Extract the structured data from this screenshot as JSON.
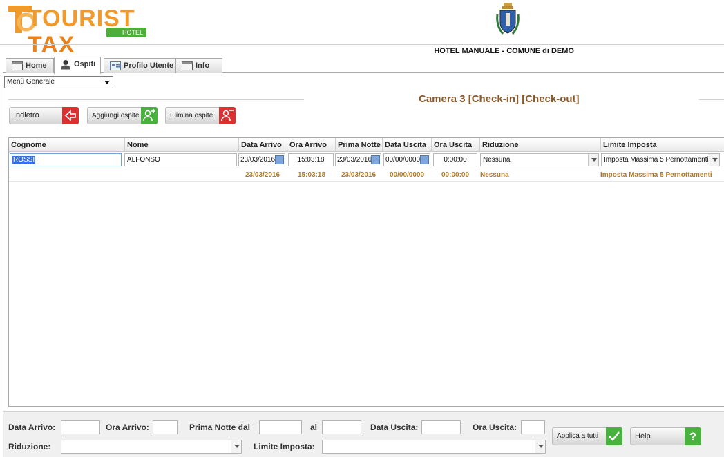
{
  "header": {
    "logo_main": "TOURIST",
    "logo_tax": "TAX",
    "logo_sub": "HOTEL",
    "hotel_name": "HOTEL MANUALE - COMUNE di DEMO"
  },
  "tabs": [
    {
      "label": "Home",
      "icon": "home-icon"
    },
    {
      "label": "Ospiti",
      "icon": "user-icon"
    },
    {
      "label": "Profilo Utente",
      "icon": "id-card-icon"
    },
    {
      "label": "Info",
      "icon": "info-icon"
    }
  ],
  "active_tab": "Ospiti",
  "menu": {
    "selected": "Menù Generale"
  },
  "room_title": "Camera 3 [Check-in] [Check-out]",
  "actions": {
    "back": "Indietro",
    "add_guest": "Aggiungi ospite",
    "delete_guest": "Elimina ospite"
  },
  "table": {
    "columns": [
      "Cognome",
      "Nome",
      "Data Arrivo",
      "Ora Arrivo",
      "Prima Notte",
      "Data Uscita",
      "Ora Uscita",
      "Riduzione",
      "Limite Imposta"
    ],
    "edit_row": {
      "cognome": "ROSSI",
      "nome": "ALFONSO",
      "data_arrivo": "23/03/2016",
      "ora_arrivo": "15:03:18",
      "prima_notte": "23/03/2016",
      "data_uscita": "00/00/0000",
      "ora_uscita": "0:00:00",
      "riduzione": "Nessuna",
      "limite_imposta": "Imposta Massima 5 Pernottamenti"
    },
    "value_row": {
      "data_arrivo": "23/03/2016",
      "ora_arrivo": "15:03:18",
      "prima_notte": "23/03/2016",
      "data_uscita": "00/00/0000",
      "ora_uscita": "00:00:00",
      "riduzione": "Nessuna",
      "limite_imposta": "Imposta Massima 5 Pernottamenti"
    }
  },
  "footer": {
    "data_arrivo_label": "Data Arrivo:",
    "ora_arrivo_label": "Ora Arrivo:",
    "prima_notte_label": "Prima Notte dal",
    "al_label": "al",
    "data_uscita_label": "Data Uscita:",
    "ora_uscita_label": "Ora Uscita:",
    "riduzione_label": "Riduzione:",
    "limite_label": "Limite Imposta:",
    "apply_all": "Applica a tutti",
    "help": "Help"
  },
  "colors": {
    "accent_orange": "#f19a2c",
    "title_brown": "#8a5a2a",
    "value_gold": "#b07a24",
    "button_red": "#d93131",
    "button_green": "#49b23f"
  }
}
